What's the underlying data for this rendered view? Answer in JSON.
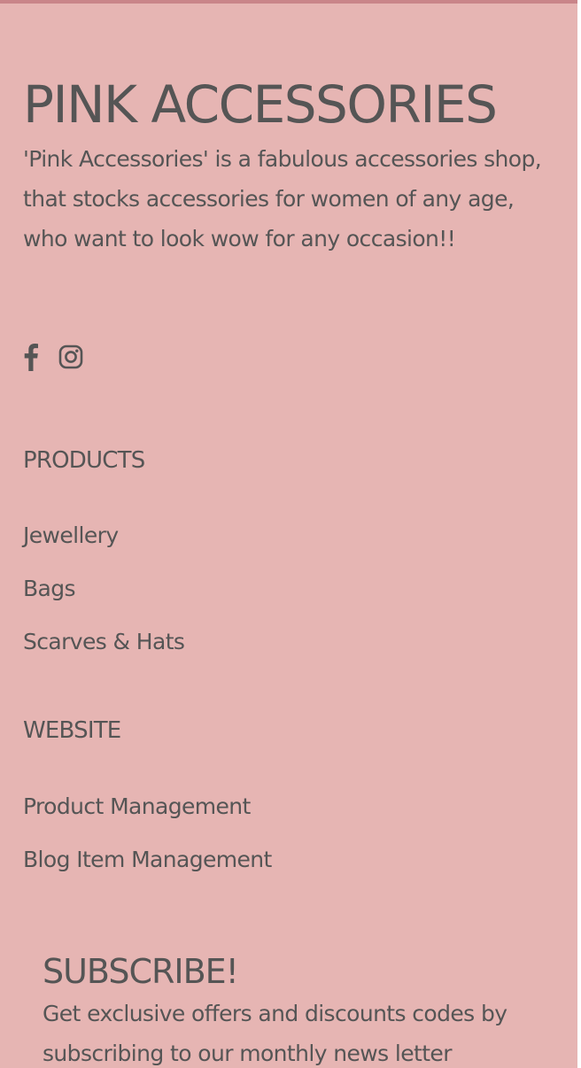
{
  "brand": {
    "title": "PINK ACCESSORIES",
    "description": "'Pink Accessories' is a fabulous accessories shop, that stocks accessories for women of any age, who want to look wow for any occasion!!"
  },
  "social": [
    {
      "icon": "facebook-icon"
    },
    {
      "icon": "instagram-icon"
    }
  ],
  "products": {
    "title": "PRODUCTS",
    "links": [
      "Jewellery",
      "Bags",
      "Scarves & Hats"
    ]
  },
  "website": {
    "title": "WEBSITE",
    "links": [
      "Product Management",
      "Blog Item Management"
    ]
  },
  "subscribe": {
    "title": "SUBSCRIBE!",
    "text": "Get exclusive offers and discounts codes by subscribing to our monthly news letter"
  },
  "colors": {
    "background": "#e6b5b3",
    "top_border": "#c98589",
    "text": "#555555"
  }
}
